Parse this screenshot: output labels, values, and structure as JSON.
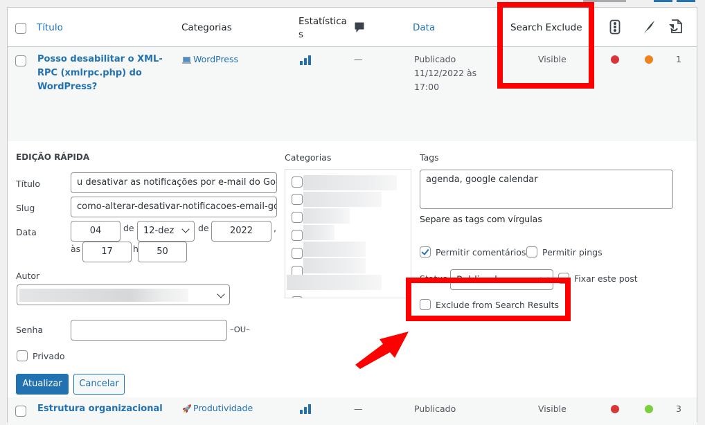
{
  "header": {
    "title_col": "Título",
    "categories_col": "Categorias",
    "stats_col": "Estatística s",
    "comments_col_icon": "comment-bubble-icon",
    "date_col": "Data",
    "search_exclude_col": "Search Exclude",
    "icon_col_1": "traffic-light-icon",
    "icon_col_2": "feather-icon",
    "icon_col_3": "document-refresh-icon"
  },
  "rows": [
    {
      "title": "Posso desabilitar o XML-RPC (xmlrpc.php) do WordPress?",
      "category_icon": "laptop-icon",
      "category": "WordPress",
      "stats_icon": "bar-chart-icon",
      "comments": "—",
      "date_status": "Publicado",
      "date": "11/12/2022 às 17:00",
      "search_exclude": "Visible",
      "dot1_color": "#d63638",
      "dot2_color": "#f0821e",
      "count": "1"
    },
    {
      "title": "Estrutura organizacional",
      "category_icon": "rocket-icon",
      "category": "Produtividade",
      "stats_icon": "bar-chart-icon",
      "comments": "—",
      "date_status": "Publicado",
      "search_exclude": "Visible",
      "dot1_color": "#d63638",
      "dot2_color": "#7ad03a",
      "count": "3"
    }
  ],
  "quick_edit": {
    "heading": "EDIÇÃO RÁPIDA",
    "title_label": "Título",
    "title_value": "u desativar as notificações por e-mail do Goo",
    "slug_label": "Slug",
    "slug_value": "como-alterar-desativar-notificacoes-email-go",
    "date_label": "Data",
    "day": "04",
    "de1": "de",
    "month": "12-dez",
    "de2": "de",
    "year": "2022",
    "comma": ",",
    "at": "às",
    "hour": "17",
    "h": "h",
    "minute": "50",
    "author_label": "Autor",
    "password_label": "Senha",
    "password_value": "",
    "or_label": "–OU–",
    "private_label": "Privado",
    "categories_label": "Categorias",
    "tags_label": "Tags",
    "tags_value": "agenda, google calendar",
    "tags_hint": "Separe as tags com vírgulas",
    "allow_comments_label": "Permitir comentários",
    "allow_comments_checked": true,
    "allow_pings_label": "Permitir pings",
    "status_label": "Status",
    "status_value": "Publicado",
    "sticky_label": "Fixar este post",
    "exclude_label": "Exclude from Search Results",
    "update_button": "Atualizar",
    "cancel_button": "Cancelar"
  },
  "annotations": {
    "highlight_color": "#ff0000"
  }
}
